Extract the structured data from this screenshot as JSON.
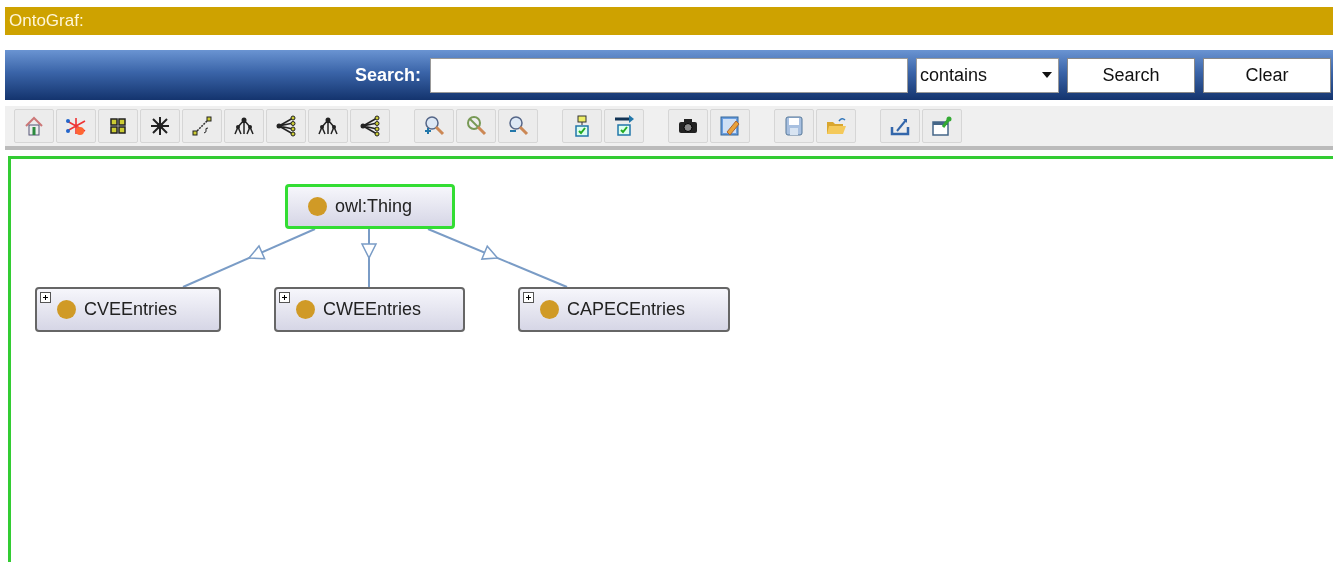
{
  "window": {
    "title": "OntoGraf:"
  },
  "search": {
    "label": "Search:",
    "mode": "contains",
    "buttons": [
      "Search",
      "Clear"
    ]
  },
  "graph": {
    "root": {
      "label": "owl:Thing",
      "selected": true,
      "expandable": false,
      "children": [
        {
          "label": "CVEEntries",
          "selected": false,
          "expandable": true
        },
        {
          "label": "CWEEntries",
          "selected": false,
          "expandable": true
        },
        {
          "label": "CAPECEntries",
          "selected": false,
          "expandable": true
        }
      ]
    }
  }
}
